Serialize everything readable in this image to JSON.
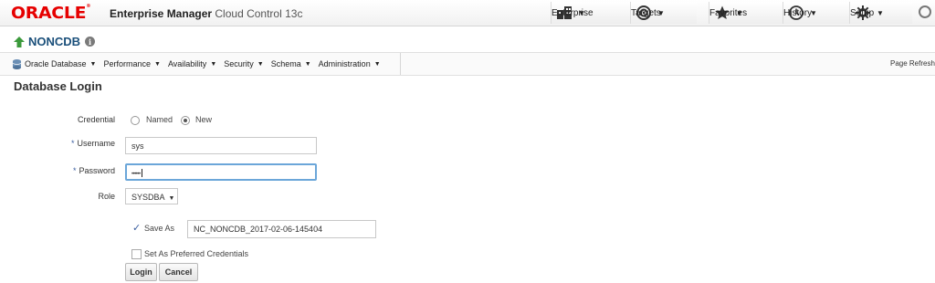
{
  "header": {
    "logo": "ORACLE",
    "logo_mark": "®",
    "product_bold": "Enterprise Manager",
    "product_rest": "Cloud Control 13c",
    "nav": [
      {
        "label": "Enterprise",
        "icon": "enterprise-icon"
      },
      {
        "label": "Targets",
        "icon": "targets-icon"
      },
      {
        "label": "Favorites",
        "icon": "favorites-star-icon"
      },
      {
        "label": "History",
        "icon": "history-clock-icon"
      },
      {
        "label": "Setup",
        "icon": "setup-gear-icon"
      }
    ]
  },
  "target": {
    "name": "NONCDB",
    "status": "up",
    "info_glyph": "i"
  },
  "menubar": {
    "menus": [
      "Oracle Database",
      "Performance",
      "Availability",
      "Security",
      "Schema",
      "Administration"
    ],
    "page_refresh": "Page Refresh"
  },
  "form": {
    "title": "Database Login",
    "credential_label": "Credential",
    "credential_options": [
      "Named",
      "New"
    ],
    "credential_selected": "New",
    "username_label": "Username",
    "username_value": "sys",
    "password_label": "Password",
    "password_value": "••••••",
    "role_label": "Role",
    "role_value": "SYSDBA",
    "save_as_label": "Save As",
    "save_as_checked": true,
    "save_as_value": "NC_NONCDB_2017-02-06-145404",
    "preferred_label": "Set As Preferred Credentials",
    "preferred_checked": false,
    "required_marker": "*",
    "login_button": "Login",
    "cancel_button": "Cancel"
  },
  "colors": {
    "brand_red": "#e60000",
    "accent_blue": "#1a4f7a",
    "focus_blue": "#6ba6d9",
    "status_green": "#3c9a3c"
  }
}
